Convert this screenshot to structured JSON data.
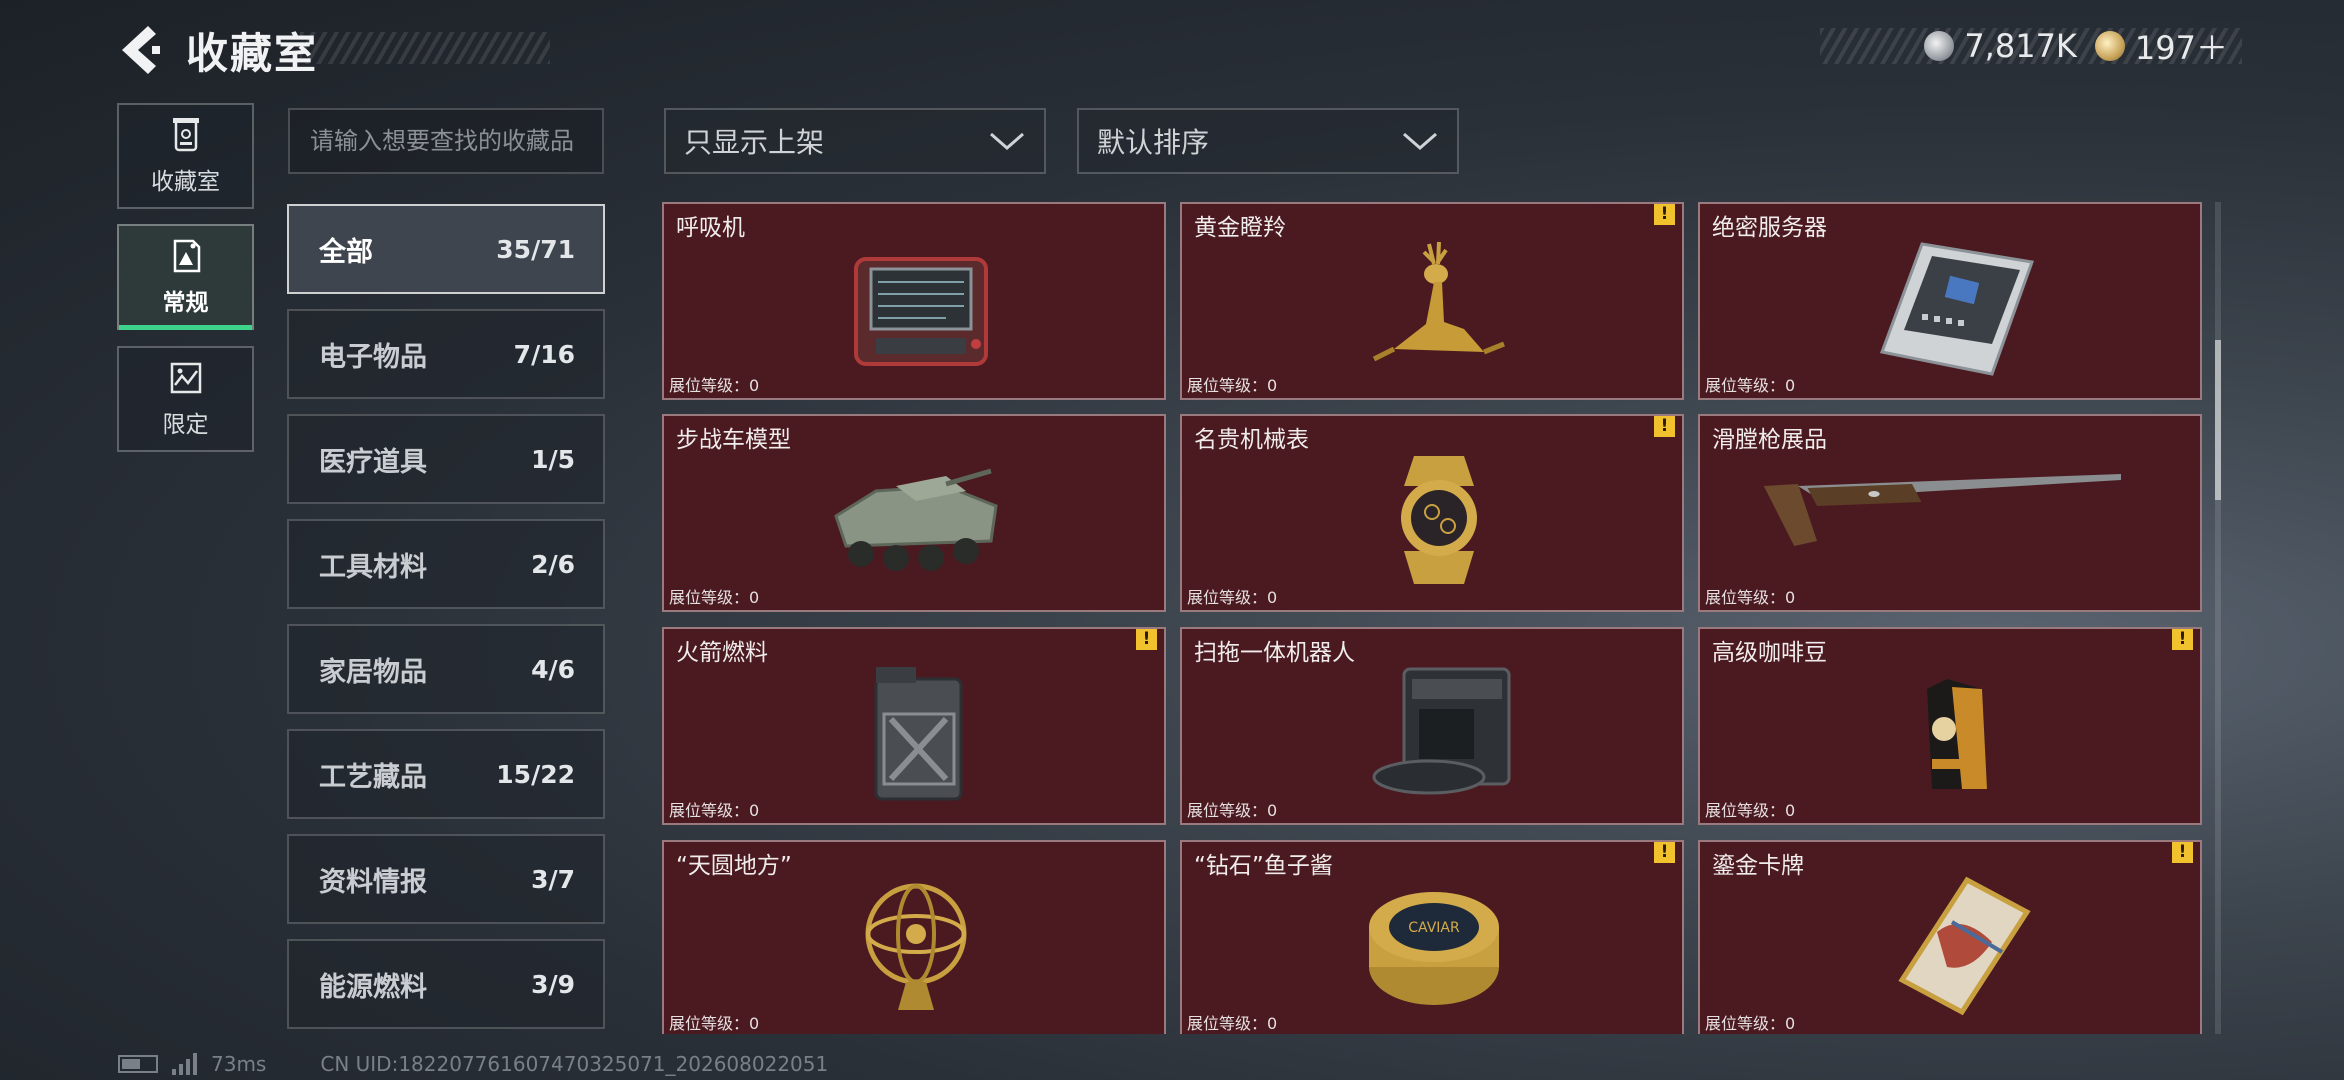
{
  "header": {
    "title": "收藏室",
    "currency": [
      {
        "icon": "silver-coin-icon",
        "value": "7,817K"
      },
      {
        "icon": "gold-coin-icon",
        "value": "197＋"
      }
    ]
  },
  "nav": [
    {
      "label": "收藏室",
      "icon": "collection-room-icon",
      "active": false
    },
    {
      "label": "常规",
      "icon": "regular-icon",
      "active": true
    },
    {
      "label": "限定",
      "icon": "limited-icon",
      "active": false
    }
  ],
  "search": {
    "placeholder": "请输入想要查找的收藏品",
    "value": ""
  },
  "categories": [
    {
      "label": "全部",
      "count": "35/71",
      "active": true
    },
    {
      "label": "电子物品",
      "count": "7/16"
    },
    {
      "label": "医疗道具",
      "count": "1/5"
    },
    {
      "label": "工具材料",
      "count": "2/6"
    },
    {
      "label": "家居物品",
      "count": "4/6"
    },
    {
      "label": "工艺藏品",
      "count": "15/22"
    },
    {
      "label": "资料情报",
      "count": "3/7"
    },
    {
      "label": "能源燃料",
      "count": "3/9"
    }
  ],
  "filters": {
    "display": "只显示上架",
    "sort": "默认排序"
  },
  "level_label": "展位等级：",
  "items": [
    {
      "name": "呼吸机",
      "level": "0",
      "warning": false,
      "icon": "ventilator-icon"
    },
    {
      "name": "黄金瞪羚",
      "level": "0",
      "warning": true,
      "icon": "golden-gazelle-icon"
    },
    {
      "name": "绝密服务器",
      "level": "0",
      "warning": false,
      "icon": "server-icon"
    },
    {
      "name": "步战车模型",
      "level": "0",
      "warning": false,
      "icon": "ifv-model-icon"
    },
    {
      "name": "名贵机械表",
      "level": "0",
      "warning": true,
      "icon": "watch-icon"
    },
    {
      "name": "滑膛枪展品",
      "level": "0",
      "warning": false,
      "icon": "musket-icon"
    },
    {
      "name": "火箭燃料",
      "level": "0",
      "warning": true,
      "icon": "fuel-can-icon"
    },
    {
      "name": "扫拖一体机器人",
      "level": "0",
      "warning": false,
      "icon": "robot-vacuum-icon"
    },
    {
      "name": "高级咖啡豆",
      "level": "0",
      "warning": true,
      "icon": "coffee-bag-icon"
    },
    {
      "name": "“天圆地方”",
      "level": "0",
      "warning": false,
      "icon": "armillary-sphere-icon"
    },
    {
      "name": "“钻石”鱼子酱",
      "level": "0",
      "warning": true,
      "icon": "caviar-tin-icon",
      "tin_text": "CAVIAR"
    },
    {
      "name": "鎏金卡牌",
      "level": "0",
      "warning": true,
      "icon": "gilded-card-icon"
    }
  ],
  "footer": {
    "ping": "73ms",
    "uid": "CN UID:182207761607470325071_202608022051"
  },
  "colors": {
    "card_bg": "#4a1a20",
    "active_nav_accent": "#3ed38a",
    "warning": "#f2c12e"
  }
}
